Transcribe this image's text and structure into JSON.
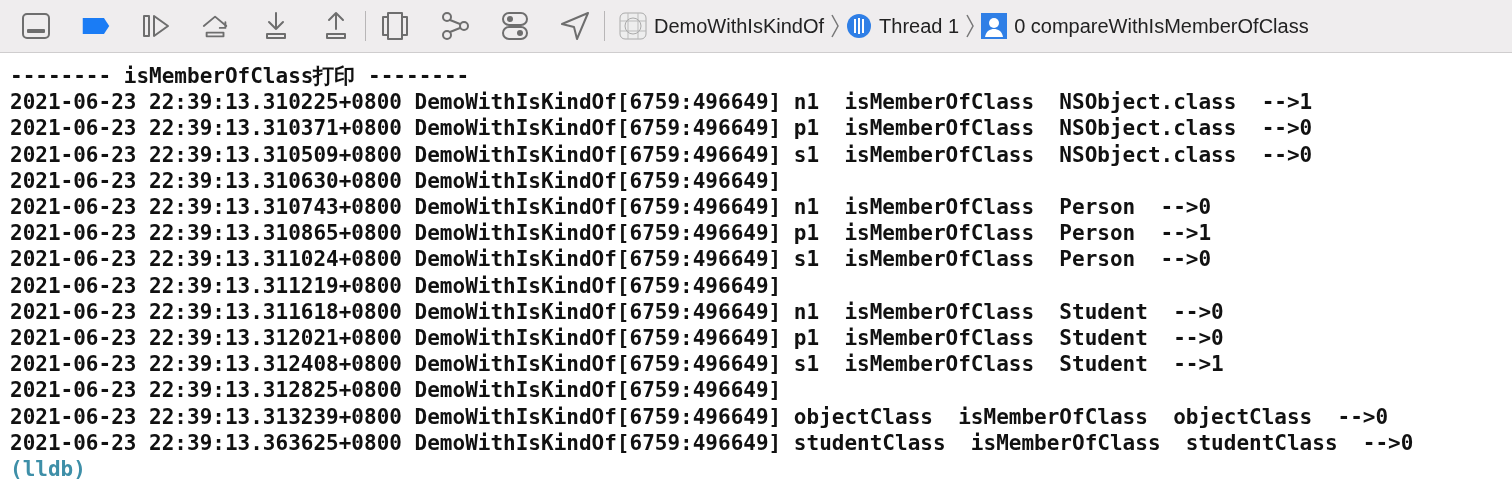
{
  "debug_bar": {
    "breakpoints_active": true,
    "breadcrumb": [
      {
        "kind": "project",
        "label": "DemoWithIsKindOf"
      },
      {
        "kind": "thread",
        "label": "Thread 1"
      },
      {
        "kind": "frame",
        "label": "0 compareWithIsMemberOfClass"
      }
    ]
  },
  "console": {
    "lines": [
      "-------- isMemberOfClass打印 --------",
      "2021-06-23 22:39:13.310225+0800 DemoWithIsKindOf[6759:496649] n1  isMemberOfClass  NSObject.class  -->1",
      "2021-06-23 22:39:13.310371+0800 DemoWithIsKindOf[6759:496649] p1  isMemberOfClass  NSObject.class  -->0",
      "2021-06-23 22:39:13.310509+0800 DemoWithIsKindOf[6759:496649] s1  isMemberOfClass  NSObject.class  -->0",
      "2021-06-23 22:39:13.310630+0800 DemoWithIsKindOf[6759:496649]",
      "2021-06-23 22:39:13.310743+0800 DemoWithIsKindOf[6759:496649] n1  isMemberOfClass  Person  -->0",
      "2021-06-23 22:39:13.310865+0800 DemoWithIsKindOf[6759:496649] p1  isMemberOfClass  Person  -->1",
      "2021-06-23 22:39:13.311024+0800 DemoWithIsKindOf[6759:496649] s1  isMemberOfClass  Person  -->0",
      "2021-06-23 22:39:13.311219+0800 DemoWithIsKindOf[6759:496649]",
      "2021-06-23 22:39:13.311618+0800 DemoWithIsKindOf[6759:496649] n1  isMemberOfClass  Student  -->0",
      "2021-06-23 22:39:13.312021+0800 DemoWithIsKindOf[6759:496649] p1  isMemberOfClass  Student  -->0",
      "2021-06-23 22:39:13.312408+0800 DemoWithIsKindOf[6759:496649] s1  isMemberOfClass  Student  -->1",
      "2021-06-23 22:39:13.312825+0800 DemoWithIsKindOf[6759:496649]",
      "2021-06-23 22:39:13.313239+0800 DemoWithIsKindOf[6759:496649] objectClass  isMemberOfClass  objectClass  -->0",
      "2021-06-23 22:39:13.363625+0800 DemoWithIsKindOf[6759:496649] studentClass  isMemberOfClass  studentClass  -->0"
    ],
    "prompt": "(lldb)"
  }
}
